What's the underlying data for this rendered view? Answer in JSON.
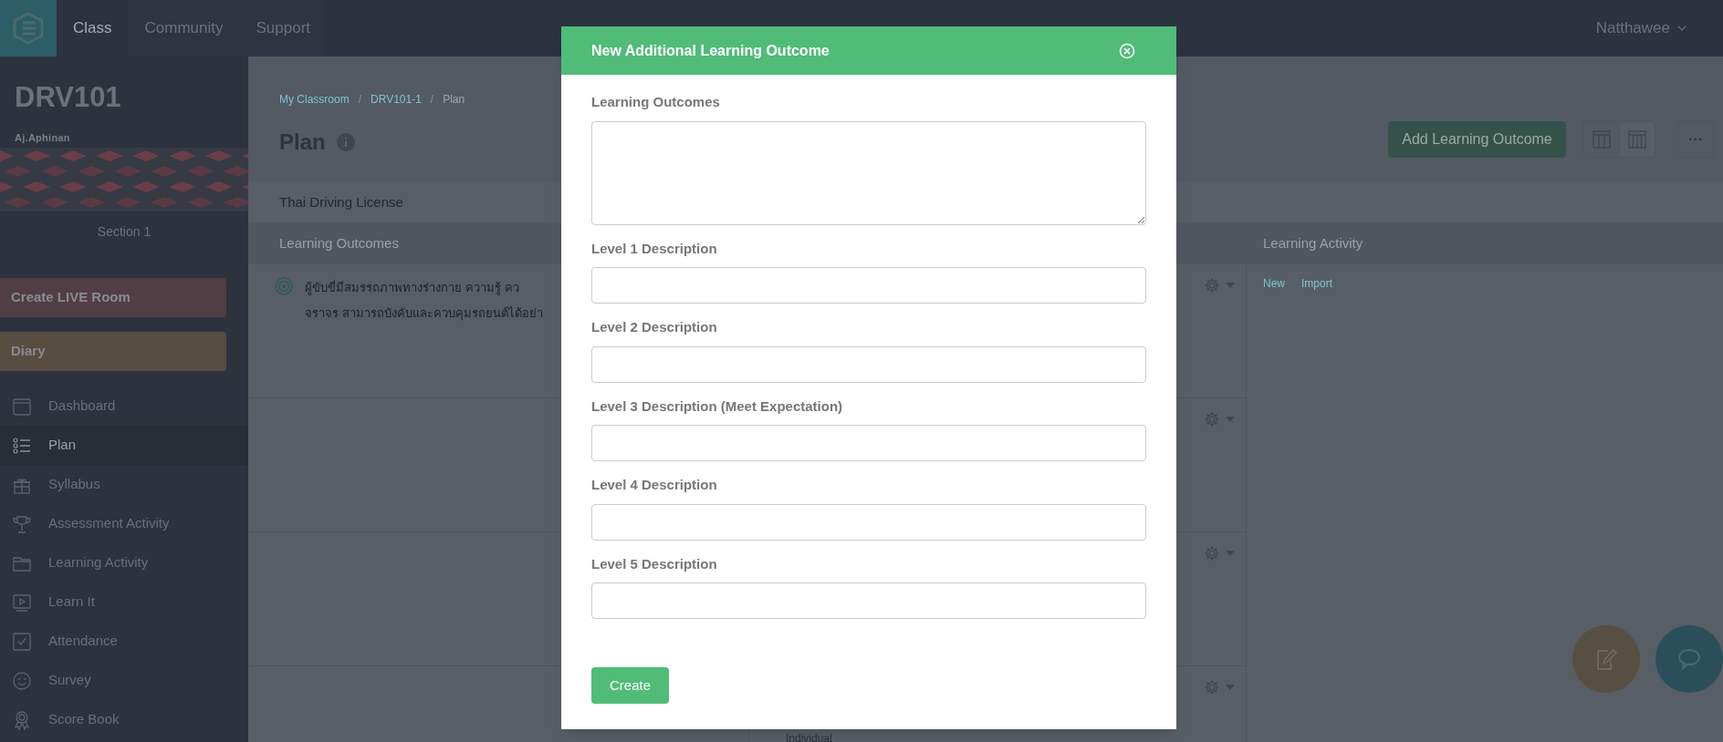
{
  "top_nav": {
    "items": [
      {
        "label": "Class",
        "selected": true
      },
      {
        "label": "Community",
        "selected": false
      },
      {
        "label": "Support",
        "selected": false
      }
    ],
    "user": "Natthawee"
  },
  "sidebar": {
    "course_code": "DRV101",
    "teacher": "Aj.Aphinan",
    "section": "Section 1",
    "buttons": [
      {
        "label": "Create LIVE Room",
        "color": "#513e45"
      },
      {
        "label": "Diary",
        "color": "#574d41"
      }
    ],
    "items": [
      {
        "label": "Dashboard",
        "selected": false
      },
      {
        "label": "Plan",
        "selected": true
      },
      {
        "label": "Syllabus",
        "selected": false
      },
      {
        "label": "Assessment Activity",
        "selected": false
      },
      {
        "label": "Learning Activity",
        "selected": false
      },
      {
        "label": "Learn It",
        "selected": false
      },
      {
        "label": "Attendance",
        "selected": false
      },
      {
        "label": "Survey",
        "selected": false
      },
      {
        "label": "Score Book",
        "selected": false
      }
    ]
  },
  "breadcrumb": [
    {
      "label": "My Classroom",
      "link": true
    },
    {
      "label": "DRV101-1",
      "link": true
    },
    {
      "label": "Plan",
      "link": false
    }
  ],
  "breadcrumb_separator": "/",
  "page_title": "Plan",
  "add_button": "Add Learning Outcome",
  "more_button": "···",
  "subject": "Thai Driving License",
  "table": {
    "columns": [
      "Learning Outcomes",
      "Learning Activity"
    ],
    "outcome_lines": [
      "ผู้ขับขี่มีสมรรถภาพทางร่างกาย  ความรู้  คว",
      "จราจร สามารถบังคับและควบคุมรถยนต์ได้อย่า"
    ],
    "activity_links": [
      "New",
      "Import"
    ],
    "footer_text": "Individual"
  },
  "modal": {
    "title": "New Additional Learning Outcome",
    "fields": [
      {
        "label": "Learning Outcomes",
        "kind": "textarea"
      },
      {
        "label": "Level 1 Description",
        "kind": "input"
      },
      {
        "label": "Level 2 Description",
        "kind": "input"
      },
      {
        "label": "Level 3 Description (Meet Expectation)",
        "kind": "input"
      },
      {
        "label": "Level 4 Description",
        "kind": "input"
      },
      {
        "label": "Level 5 Description",
        "kind": "input"
      }
    ],
    "submit": "Create"
  }
}
